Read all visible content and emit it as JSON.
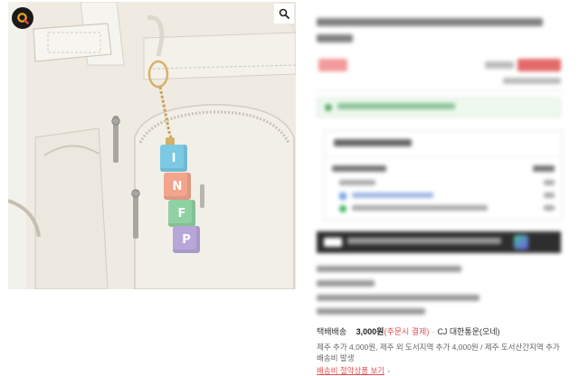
{
  "product_image": {
    "keychain_letters": [
      "I",
      "N",
      "F",
      "P"
    ],
    "keychain_colors": [
      "#7cc9e3",
      "#f2a58c",
      "#8fd1a2",
      "#b7a6d8"
    ]
  },
  "icons": {
    "brand": "brand-logo-icon",
    "zoom": "magnifier-icon"
  },
  "shipping": {
    "label": "택배배송",
    "fee": "3,000원",
    "condition": "(주문시 결제)",
    "separator": "·",
    "carrier": "CJ 대한통운(오네)",
    "extra_fee_note": "제주 추가 4,000원, 제주 외 도서지역 추가 4,000원 / 제주 도서산간지역 추가배송비 발생",
    "link_label": "배송비 절약상품 보기",
    "link_chevron": "›"
  },
  "colors": {
    "accent_red": "#e05252",
    "sale_red": "#e43d3d",
    "discount_pink": "#f26b6b",
    "benefit_green": "#55aa66",
    "banner_dark": "#2e2e2e"
  }
}
